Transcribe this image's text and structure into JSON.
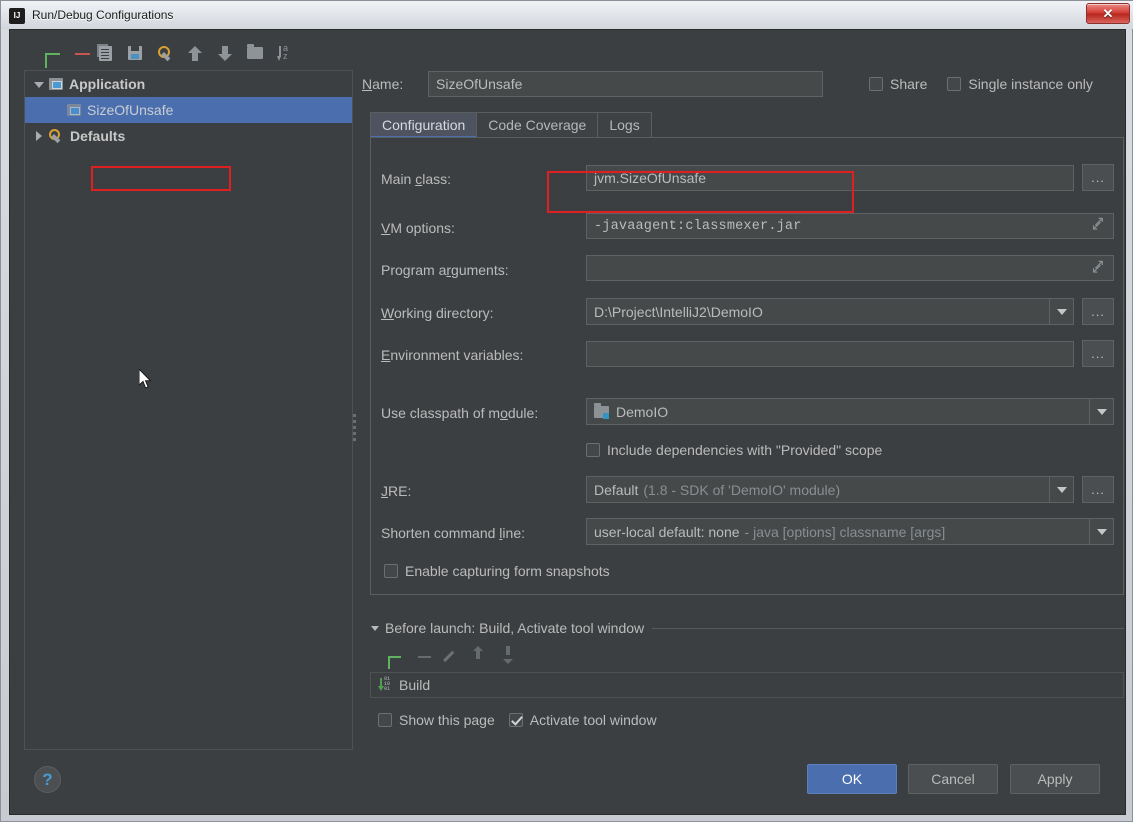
{
  "window": {
    "title": "Run/Debug Configurations",
    "app_icon": "intellij-idea-icon",
    "close_label": "✕"
  },
  "left_toolbar": {
    "buttons": [
      {
        "name": "add-configuration-button",
        "icon": "plus-icon"
      },
      {
        "name": "remove-configuration-button",
        "icon": "minus-icon"
      },
      {
        "name": "copy-configuration-button",
        "icon": "copy-icon"
      },
      {
        "name": "save-configuration-button",
        "icon": "save-icon"
      },
      {
        "name": "edit-defaults-button",
        "icon": "wrench-icon"
      },
      {
        "name": "move-up-button",
        "icon": "arrow-up-icon"
      },
      {
        "name": "move-down-button",
        "icon": "folder-icon"
      },
      {
        "name": "create-folder-button",
        "icon": "folder-icon"
      },
      {
        "name": "sort-configurations-button",
        "icon": "sort-az-icon"
      }
    ]
  },
  "tree": {
    "nodes": [
      {
        "label": "Application",
        "icon": "application-icon",
        "expanded": true,
        "selected": false,
        "level": 0
      },
      {
        "label": "SizeOfUnsafe",
        "icon": "application-icon",
        "expanded": false,
        "selected": true,
        "level": 1
      },
      {
        "label": "Defaults",
        "icon": "wrench-icon",
        "expanded": false,
        "selected": false,
        "level": 0
      }
    ]
  },
  "name_row": {
    "label": "Name:",
    "value": "SizeOfUnsafe",
    "share": {
      "label": "Share",
      "checked": false
    },
    "single_instance": {
      "label": "Single instance only",
      "checked": false
    }
  },
  "tabs": [
    {
      "label": "Configuration",
      "active": true
    },
    {
      "label": "Code Coverage",
      "active": false
    },
    {
      "label": "Logs",
      "active": false
    }
  ],
  "fields": {
    "main_class": {
      "label": "Main class:",
      "value": "jvm.SizeOfUnsafe",
      "browse": "..."
    },
    "vm_options": {
      "label": "VM options:",
      "value": "-javaagent:classmexer.jar",
      "highlighted": true
    },
    "program_arguments": {
      "label": "Program arguments:",
      "value": ""
    },
    "working_directory": {
      "label": "Working directory:",
      "value": "D:\\Project\\IntelliJ2\\DemoIO",
      "browse": "..."
    },
    "environment_variables": {
      "label": "Environment variables:",
      "value": "",
      "browse": "..."
    },
    "use_classpath_of_module": {
      "label": "Use classpath of module:",
      "value": "DemoIO",
      "icon": "module-icon"
    },
    "include_provided": {
      "label": "Include dependencies with \"Provided\" scope",
      "checked": false
    },
    "jre": {
      "label": "JRE:",
      "value": "Default",
      "value_hint": "(1.8 - SDK of 'DemoIO' module)",
      "browse": "..."
    },
    "shorten_command_line": {
      "label": "Shorten command line:",
      "value": "user-local default: none",
      "value_hint": "- java [options] classname [args]"
    },
    "enable_form_snapshots": {
      "label": "Enable capturing form snapshots",
      "checked": false
    }
  },
  "before_launch": {
    "header": "Before launch: Build, Activate tool window",
    "toolbar": [
      {
        "name": "before-launch-add-button",
        "icon": "plus-icon"
      },
      {
        "name": "before-launch-remove-button",
        "icon": "minus-icon"
      },
      {
        "name": "before-launch-edit-button",
        "icon": "pencil-icon"
      },
      {
        "name": "before-launch-move-up-button",
        "icon": "arrow-up-icon"
      },
      {
        "name": "before-launch-move-down-button",
        "icon": "arrow-down-icon"
      }
    ],
    "tasks": [
      {
        "label": "Build",
        "icon": "build-icon"
      }
    ],
    "show_this_page": {
      "label": "Show this page",
      "checked": false
    },
    "activate_tool_window": {
      "label": "Activate tool window",
      "checked": true
    }
  },
  "bottom_bar": {
    "help": "?",
    "ok": "OK",
    "cancel": "Cancel",
    "apply": "Apply"
  },
  "colors": {
    "accent_blue": "#4b6eaf",
    "highlight_red": "#e02020",
    "panel_bg": "#3c3f41",
    "field_bg": "#45494a"
  }
}
